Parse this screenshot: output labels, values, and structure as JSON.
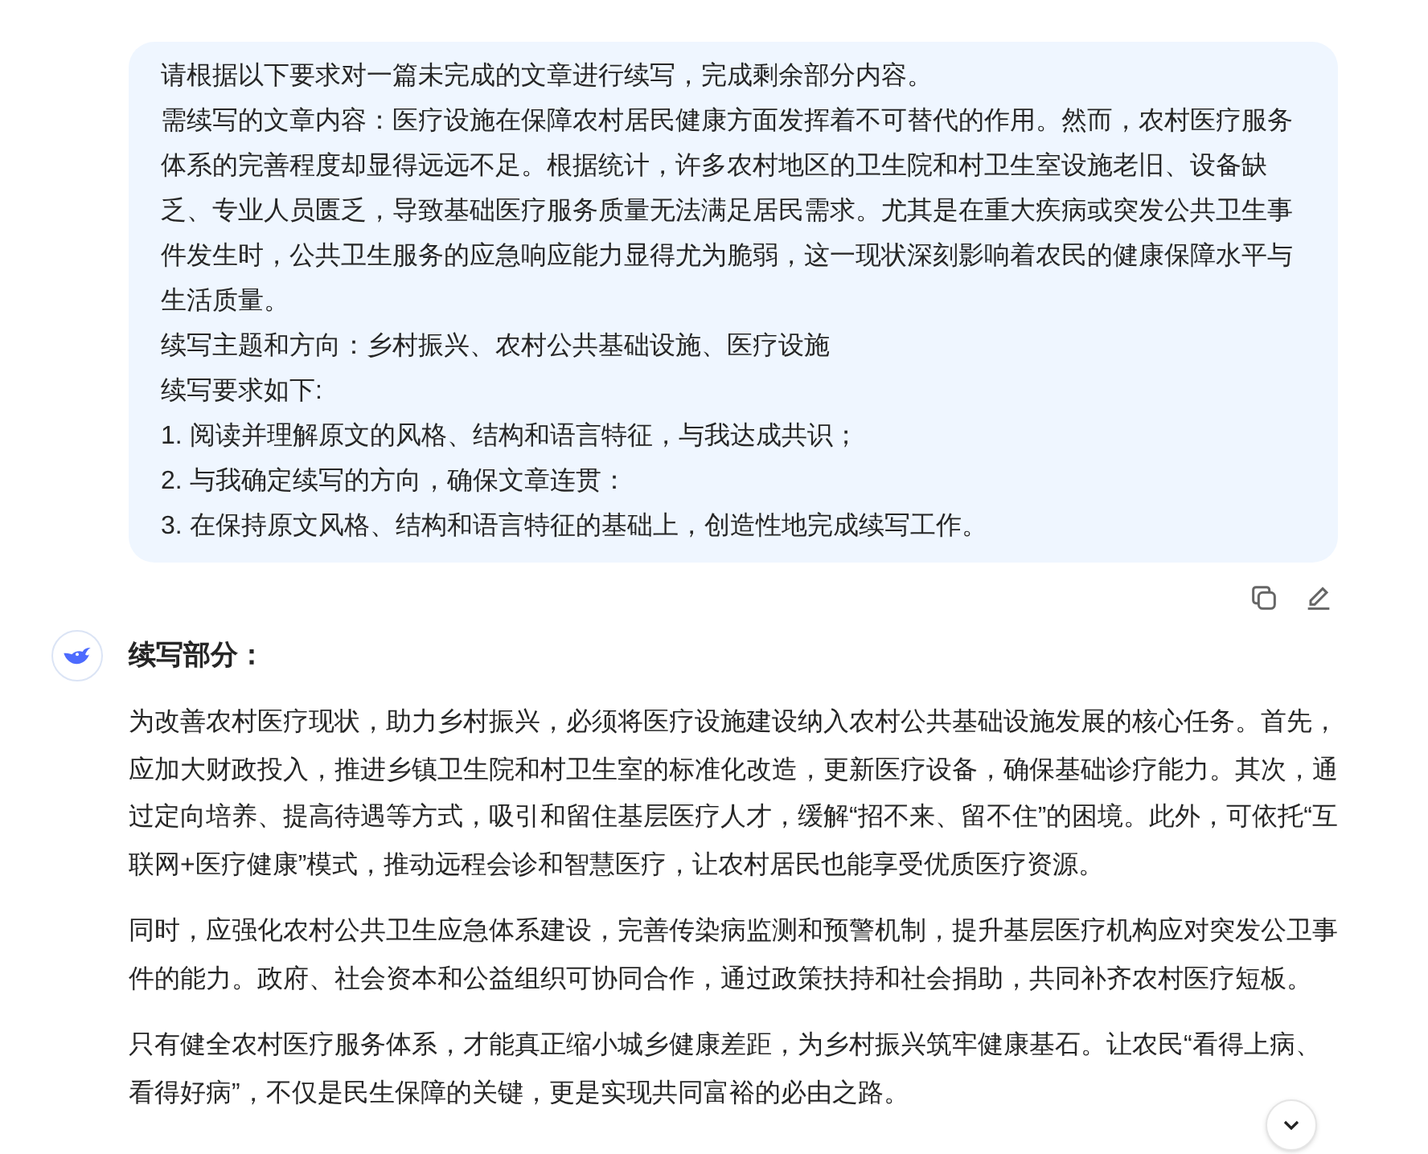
{
  "user_message": {
    "lines": [
      "请根据以下要求对一篇未完成的文章进行续写，完成剩余部分内容。",
      "需续写的文章内容：医疗设施在保障农村居民健康方面发挥着不可替代的作用。然而，农村医疗服务体系的完善程度却显得远远不足。根据统计，许多农村地区的卫生院和村卫生室设施老旧、设备缺乏、专业人员匮乏，导致基础医疗服务质量无法满足居民需求。尤其是在重大疾病或突发公共卫生事件发生时，公共卫生服务的应急响应能力显得尤为脆弱，这一现状深刻影响着农民的健康保障水平与生活质量。",
      "续写主题和方向：乡村振兴、农村公共基础设施、医疗设施",
      "续写要求如下:",
      "1. 阅读并理解原文的风格、结构和语言特征，与我达成共识；",
      "2. 与我确定续写的方向，确保文章连贯：",
      "3. 在保持原文风格、结构和语言特征的基础上，创造性地完成续写工作。"
    ]
  },
  "reply": {
    "title": "续写部分：",
    "paragraphs": [
      "为改善农村医疗现状，助力乡村振兴，必须将医疗设施建设纳入农村公共基础设施发展的核心任务。首先，应加大财政投入，推进乡镇卫生院和村卫生室的标准化改造，更新医疗设备，确保基础诊疗能力。其次，通过定向培养、提高待遇等方式，吸引和留住基层医疗人才，缓解“招不来、留不住”的困境。此外，可依托“互联网+医疗健康”模式，推动远程会诊和智慧医疗，让农村居民也能享受优质医疗资源。",
      "同时，应强化农村公共卫生应急体系建设，完善传染病监测和预警机制，提升基层医疗机构应对突发公卫事件的能力。政府、社会资本和公益组织可协同合作，通过政策扶持和社会捐助，共同补齐农村医疗短板。",
      "只有健全农村医疗服务体系，才能真正缩小城乡健康差距，为乡村振兴筑牢健康基石。让农民“看得上病、看得好病”，不仅是民生保障的关键，更是实现共同富裕的必由之路。"
    ]
  }
}
